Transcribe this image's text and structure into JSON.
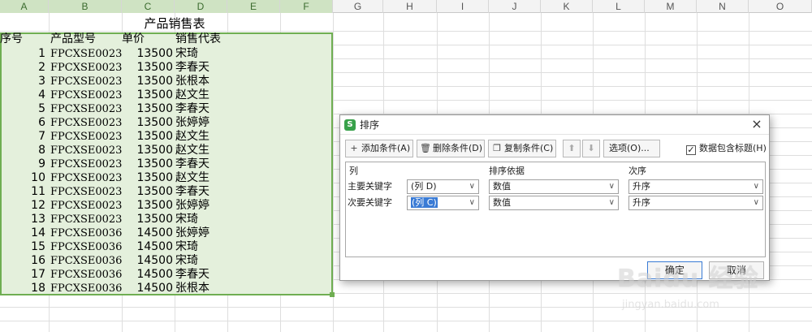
{
  "columns": [
    "A",
    "B",
    "C",
    "D",
    "E",
    "F",
    "G",
    "H",
    "I",
    "J",
    "K",
    "L",
    "M",
    "N",
    "O"
  ],
  "table": {
    "title": "产品销售表",
    "headers": [
      "序号",
      "产品型号",
      "单价",
      "销售代表"
    ],
    "rows": [
      [
        "1",
        "FPCXSE0023",
        "13500",
        "宋琦"
      ],
      [
        "2",
        "FPCXSE0023",
        "13500",
        "李春天"
      ],
      [
        "3",
        "FPCXSE0023",
        "13500",
        "张根本"
      ],
      [
        "4",
        "FPCXSE0023",
        "13500",
        "赵文生"
      ],
      [
        "5",
        "FPCXSE0023",
        "13500",
        "李春天"
      ],
      [
        "6",
        "FPCXSE0023",
        "13500",
        "张婷婷"
      ],
      [
        "7",
        "FPCXSE0023",
        "13500",
        "赵文生"
      ],
      [
        "8",
        "FPCXSE0023",
        "13500",
        "赵文生"
      ],
      [
        "9",
        "FPCXSE0023",
        "13500",
        "李春天"
      ],
      [
        "10",
        "FPCXSE0023",
        "13500",
        "赵文生"
      ],
      [
        "11",
        "FPCXSE0023",
        "13500",
        "李春天"
      ],
      [
        "12",
        "FPCXSE0023",
        "13500",
        "张婷婷"
      ],
      [
        "13",
        "FPCXSE0023",
        "13500",
        "宋琦"
      ],
      [
        "14",
        "FPCXSE0036",
        "14500",
        "张婷婷"
      ],
      [
        "15",
        "FPCXSE0036",
        "14500",
        "宋琦"
      ],
      [
        "16",
        "FPCXSE0036",
        "14500",
        "宋琦"
      ],
      [
        "17",
        "FPCXSE0036",
        "14500",
        "李春天"
      ],
      [
        "18",
        "FPCXSE0036",
        "14500",
        "张根本"
      ]
    ]
  },
  "dialog": {
    "title": "排序",
    "close": "×",
    "logo": "S",
    "toolbar": {
      "add": "添加条件(A)",
      "delete": "删除条件(D)",
      "copy": "复制条件(C)",
      "up": "⬆",
      "down": "⬇",
      "options": "选项(O)...",
      "has_header_label": "数据包含标题(H)",
      "has_header_checked": "✓"
    },
    "columns_header": {
      "col": "列",
      "basis": "排序依据",
      "order": "次序"
    },
    "rows": [
      {
        "label": "主要关键字",
        "key": "(列 D)",
        "basis": "数值",
        "order": "升序"
      },
      {
        "label": "次要关键字",
        "key": "(列 C)",
        "basis": "数值",
        "order": "升序"
      }
    ],
    "ok": "确定",
    "cancel": "取消"
  },
  "watermark": {
    "main": "Baidu 经验",
    "sub": "jingyan.baidu.com"
  },
  "colors": {
    "selection_fill": "#e4f0dc",
    "selection_border": "#6fae52",
    "accent": "#3a7bd5"
  }
}
